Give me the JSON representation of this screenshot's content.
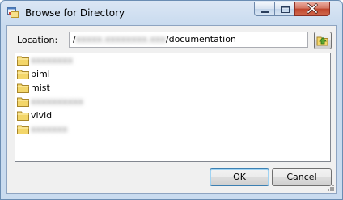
{
  "window": {
    "title": "Browse for Directory",
    "icons": {
      "app": "browse-window-icon",
      "minimize": "minimize-icon",
      "maximize": "maximize-icon",
      "close": "close-icon"
    }
  },
  "location": {
    "label": "Location:",
    "prefix": "/",
    "host_redacted": "xxxxx.xxxxxxxx.xxx",
    "suffix": "/documentation",
    "up_button_icon": "folder-up-icon"
  },
  "directories": [
    {
      "name": "xxxxxxxx",
      "redacted": true
    },
    {
      "name": "biml",
      "redacted": false
    },
    {
      "name": "mist",
      "redacted": false
    },
    {
      "name": "xxxxxxxxxx",
      "redacted": true
    },
    {
      "name": "vivid",
      "redacted": false
    },
    {
      "name": "xxxxxxx",
      "redacted": true
    }
  ],
  "buttons": {
    "ok": "OK",
    "cancel": "Cancel"
  },
  "colors": {
    "titlebar": "#c9dbef",
    "client": "#f0f0f0",
    "close_button": "#c0452c",
    "folder": "#f3d66a"
  }
}
